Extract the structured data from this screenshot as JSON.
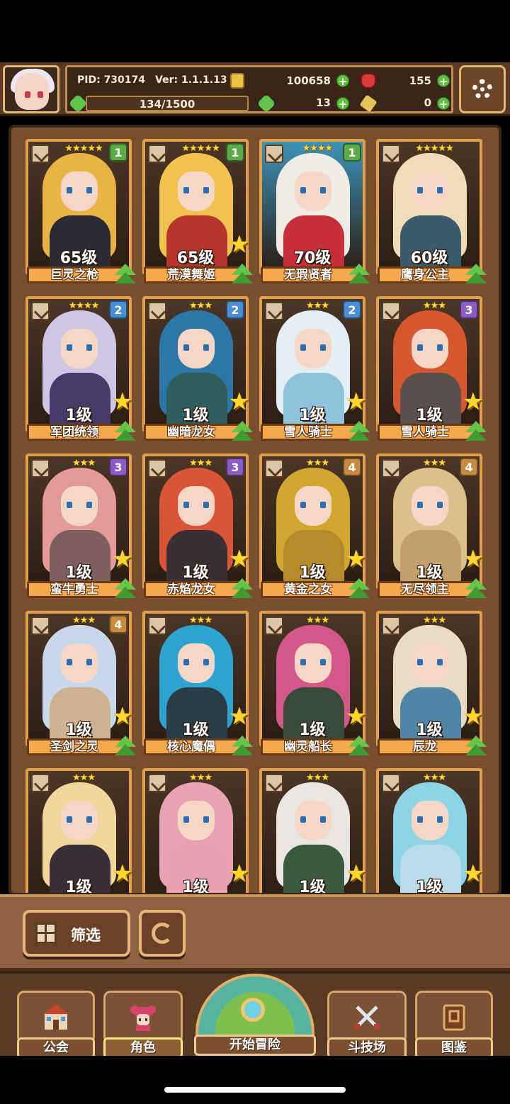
{
  "hud": {
    "pid": "PID: 730174",
    "version": "Ver: 1.1.1.13",
    "exp": "134/1500",
    "gold": "100658",
    "ruby": "155",
    "clover": "13",
    "key": "0"
  },
  "roster": [
    {
      "name": "巨灵之枪",
      "level": "65级",
      "tier": "1",
      "stars": "★★★★★",
      "tier_color": "#5cab47",
      "hair": "#e8b444",
      "body": "#2d2a33",
      "bg": "#4b3626",
      "bigstar": false
    },
    {
      "name": "荒漠舞姬",
      "level": "65级",
      "tier": "1",
      "stars": "★★★★★",
      "tier_color": "#5cab47",
      "hair": "#f2c24e",
      "body": "#b8352c",
      "bg": "#4b3626",
      "bigstar": true
    },
    {
      "name": "无瑕贤者",
      "level": "70级",
      "tier": "1",
      "stars": "★★★★",
      "tier_color": "#5cab47",
      "hair": "#efece6",
      "body": "#c7303a",
      "bg": "#3d93b8",
      "bigstar": false
    },
    {
      "name": "鹰身公主",
      "level": "60级",
      "tier": "",
      "stars": "★★★★★",
      "tier_color": "#5cab47",
      "hair": "#f0dcb8",
      "body": "#3b5a6b",
      "bg": "#4b3626",
      "bigstar": false
    },
    {
      "name": "军团统领",
      "level": "1级",
      "tier": "2",
      "stars": "★★★★",
      "tier_color": "#4a8fd6",
      "hair": "#cfc6e6",
      "body": "#463a66",
      "bg": "#4b3626",
      "bigstar": true
    },
    {
      "name": "幽暗龙女",
      "level": "1级",
      "tier": "2",
      "stars": "★★★",
      "tier_color": "#4a8fd6",
      "hair": "#2c77a8",
      "body": "#2f5e60",
      "bg": "#4b3626",
      "bigstar": true
    },
    {
      "name": "雪人骑士",
      "level": "1级",
      "tier": "2",
      "stars": "★★★",
      "tier_color": "#4a8fd6",
      "hair": "#e3eef5",
      "body": "#8fc3dc",
      "bg": "#4b3626",
      "bigstar": true
    },
    {
      "name": "雪人骑士",
      "level": "1级",
      "tier": "3",
      "stars": "★★★",
      "tier_color": "#8a5cc4",
      "hair": "#d6562e",
      "body": "#5a5050",
      "bg": "#4b3626",
      "bigstar": true
    },
    {
      "name": "蛮牛勇士",
      "level": "1级",
      "tier": "3",
      "stars": "★★★",
      "tier_color": "#8a5cc4",
      "hair": "#e59a9a",
      "body": "#7d5f5f",
      "bg": "#4b3626",
      "bigstar": true
    },
    {
      "name": "赤焰龙女",
      "level": "1级",
      "tier": "3",
      "stars": "★★★",
      "tier_color": "#8a5cc4",
      "hair": "#d95536",
      "body": "#3a2f33",
      "bg": "#4b3626",
      "bigstar": true
    },
    {
      "name": "黄金之女",
      "level": "1级",
      "tier": "4",
      "stars": "★★★",
      "tier_color": "#c88a3e",
      "hair": "#d1a631",
      "body": "#b58a2a",
      "bg": "#4b3626",
      "bigstar": true
    },
    {
      "name": "无尽领主",
      "level": "1级",
      "tier": "4",
      "stars": "★★★",
      "tier_color": "#c88a3e",
      "hair": "#dcc08c",
      "body": "#c3a06b",
      "bg": "#4b3626",
      "bigstar": true
    },
    {
      "name": "圣剑之灵",
      "level": "1级",
      "tier": "4",
      "stars": "★★★",
      "tier_color": "#c88a3e",
      "hair": "#c8d8ea",
      "body": "#cdb38f",
      "bg": "#4b3626",
      "bigstar": true
    },
    {
      "name": "核心魔偶",
      "level": "1级",
      "tier": "",
      "stars": "★★★",
      "tier_color": "#c88a3e",
      "hair": "#2da3d0",
      "body": "#2a3c48",
      "bg": "#4b3626",
      "bigstar": true
    },
    {
      "name": "幽灵船长",
      "level": "1级",
      "tier": "",
      "stars": "★★★",
      "tier_color": "#c88a3e",
      "hair": "#d4578a",
      "body": "#3a4a3a",
      "bg": "#4b3626",
      "bigstar": true
    },
    {
      "name": "辰龙",
      "level": "1级",
      "tier": "",
      "stars": "★★★",
      "tier_color": "#c88a3e",
      "hair": "#eadbc4",
      "body": "#4f86a8",
      "bg": "#4b3626",
      "bigstar": true
    },
    {
      "name": "",
      "level": "1级",
      "tier": "",
      "stars": "★★★",
      "tier_color": "#c88a3e",
      "hair": "#f1d79c",
      "body": "#3a2f36",
      "bg": "#4b3626",
      "bigstar": true
    },
    {
      "name": "",
      "level": "1级",
      "tier": "",
      "stars": "★★★",
      "tier_color": "#c88a3e",
      "hair": "#e7a3b3",
      "body": "#e8a0b2",
      "bg": "#4b3626",
      "bigstar": true
    },
    {
      "name": "",
      "level": "1级",
      "tier": "",
      "stars": "★★★",
      "tier_color": "#c88a3e",
      "hair": "#e9e5e2",
      "body": "#3c5a3f",
      "bg": "#4b3626",
      "bigstar": true
    },
    {
      "name": "",
      "level": "1级",
      "tier": "",
      "stars": "★★★",
      "tier_color": "#c88a3e",
      "hair": "#8fd3e6",
      "body": "#b9dbe8",
      "bg": "#4b3626",
      "bigstar": true
    }
  ],
  "filter": {
    "label": "筛选"
  },
  "nav": {
    "guild": "公会",
    "character": "角色",
    "adventure": "开始冒险",
    "arena": "斗技场",
    "codex": "图鉴"
  },
  "colors": {
    "accent": "#e2a04a",
    "panel": "#7a4f2f",
    "upgrade": "#63c64b"
  }
}
